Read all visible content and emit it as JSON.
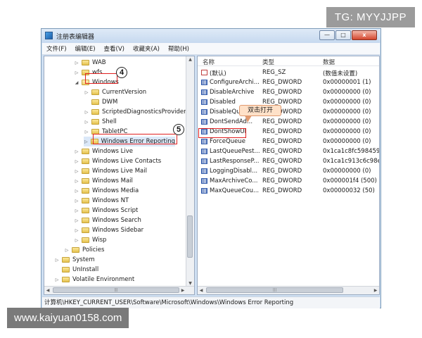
{
  "watermarks": {
    "top_right": "TG: MYYJJPP",
    "bottom_left": "www.kaiyuan0158.com"
  },
  "window": {
    "title": "注册表编辑器",
    "buttons": {
      "minimize": "—",
      "maximize": "□",
      "close": "x"
    }
  },
  "menu": [
    "文件(F)",
    "编辑(E)",
    "查看(V)",
    "收藏夹(A)",
    "帮助(H)"
  ],
  "tree": [
    {
      "label": "WAB",
      "expander": "▷"
    },
    {
      "label": "wfs",
      "expander": "▷"
    },
    {
      "label": "Windows",
      "expander": "◢"
    },
    {
      "label": "CurrentVersion",
      "expander": "▷"
    },
    {
      "label": "DWM",
      "expander": ""
    },
    {
      "label": "ScriptedDiagnosticsProvider",
      "expander": "▷"
    },
    {
      "label": "Shell",
      "expander": "▷"
    },
    {
      "label": "TabletPC",
      "expander": "▷"
    },
    {
      "label": "Windows Error Reporting",
      "expander": "▷"
    },
    {
      "label": "Windows Live",
      "expander": "▷"
    },
    {
      "label": "Windows Live Contacts",
      "expander": "▷"
    },
    {
      "label": "Windows Live Mail",
      "expander": "▷"
    },
    {
      "label": "Windows Mail",
      "expander": "▷"
    },
    {
      "label": "Windows Media",
      "expander": "▷"
    },
    {
      "label": "Windows NT",
      "expander": "▷"
    },
    {
      "label": "Windows Script",
      "expander": "▷"
    },
    {
      "label": "Windows Search",
      "expander": "▷"
    },
    {
      "label": "Windows Sidebar",
      "expander": "▷"
    },
    {
      "label": "Wisp",
      "expander": "▷"
    },
    {
      "label": "Policies",
      "expander": "▷"
    },
    {
      "label": "System",
      "expander": "▷"
    },
    {
      "label": "UnInstall",
      "expander": ""
    },
    {
      "label": "Volatile Environment",
      "expander": "▷"
    }
  ],
  "columns": {
    "name": "名称",
    "type": "类型",
    "data": "数据"
  },
  "values": [
    {
      "name": "(默认)",
      "type": "REG_SZ",
      "data": "(数值未设置)",
      "icon": "string-value-icon"
    },
    {
      "name": "ConfigureArchi...",
      "type": "REG_DWORD",
      "data": "0x00000001 (1)",
      "icon": "dword-value-icon"
    },
    {
      "name": "DisableArchive",
      "type": "REG_DWORD",
      "data": "0x00000000 (0)",
      "icon": "dword-value-icon"
    },
    {
      "name": "Disabled",
      "type": "REG_DWORD",
      "data": "0x00000000 (0)",
      "icon": "dword-value-icon"
    },
    {
      "name": "DisableQu...",
      "type": "REG_DWORD",
      "data": "0x00000000 (0)",
      "icon": "dword-value-icon"
    },
    {
      "name": "DontSendAd...",
      "type": "REG_DWORD",
      "data": "0x00000000 (0)",
      "icon": "dword-value-icon"
    },
    {
      "name": "DontShowUI",
      "type": "REG_DWORD",
      "data": "0x00000000 (0)",
      "icon": "dword-value-icon"
    },
    {
      "name": "ForceQueue",
      "type": "REG_DWORD",
      "data": "0x00000000 (0)",
      "icon": "dword-value-icon"
    },
    {
      "name": "LastQueuePest...",
      "type": "REG_QWORD",
      "data": "0x1ca1c8fc5984597",
      "icon": "qword-value-icon"
    },
    {
      "name": "LastResponseP...",
      "type": "REG_QWORD",
      "data": "0x1ca1c913c6c98ec",
      "icon": "qword-value-icon"
    },
    {
      "name": "LoggingDisabl...",
      "type": "REG_DWORD",
      "data": "0x00000000 (0)",
      "icon": "dword-value-icon"
    },
    {
      "name": "MaxArchiveCo...",
      "type": "REG_DWORD",
      "data": "0x000001f4 (500)",
      "icon": "dword-value-icon"
    },
    {
      "name": "MaxQueueCou...",
      "type": "REG_DWORD",
      "data": "0x00000032 (50)",
      "icon": "dword-value-icon"
    }
  ],
  "annotations": {
    "step4": "4",
    "step5": "5",
    "callout": "双击打开"
  },
  "scroll_glyphs": {
    "up": "▲",
    "down": "▼",
    "left": "◀",
    "right": "▶",
    "grip": "|||"
  },
  "status": "计算机\\HKEY_CURRENT_USER\\Software\\Microsoft\\Windows\\Windows Error Reporting"
}
